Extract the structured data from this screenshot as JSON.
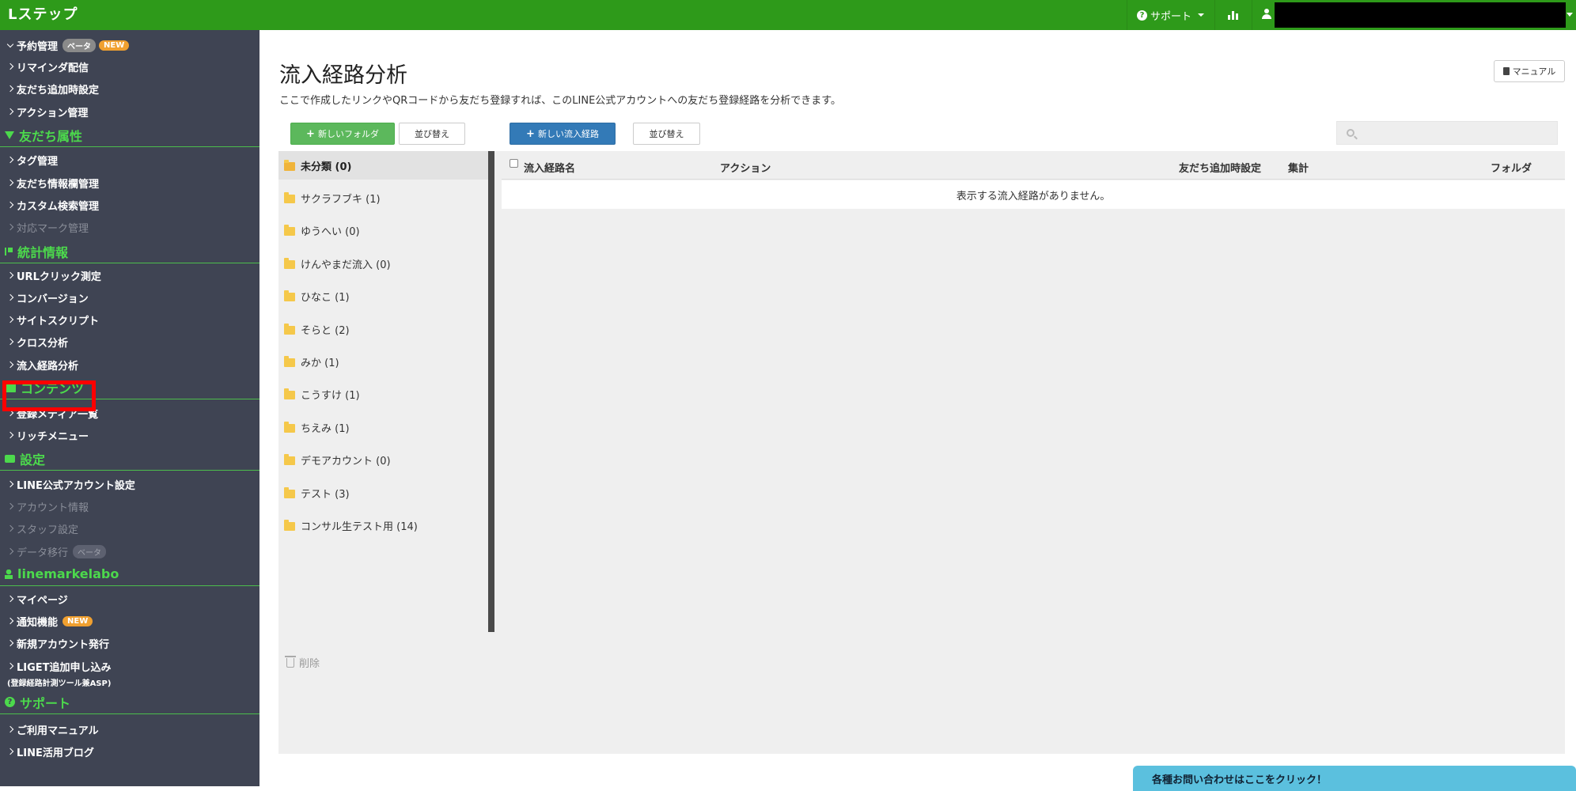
{
  "app": {
    "logo": "Lステップ"
  },
  "topbar": {
    "support_label": "サポート"
  },
  "sidebar": {
    "items": [
      {
        "label": "予約管理",
        "badges": [
          "ベータ",
          "NEW"
        ]
      },
      {
        "label": "リマインダ配信"
      },
      {
        "label": "友だち追加時設定"
      },
      {
        "label": "アクション管理"
      },
      {
        "label": "タグ管理"
      },
      {
        "label": "友だち情報欄管理"
      },
      {
        "label": "カスタム検索管理"
      },
      {
        "label": "対応マーク管理"
      },
      {
        "label": "URLクリック測定"
      },
      {
        "label": "コンバージョン"
      },
      {
        "label": "サイトスクリプト"
      },
      {
        "label": "クロス分析"
      },
      {
        "label": "流入経路分析"
      },
      {
        "label": "登録メディア一覧"
      },
      {
        "label": "リッチメニュー"
      },
      {
        "label": "LINE公式アカウント設定"
      },
      {
        "label": "アカウント情報"
      },
      {
        "label": "スタッフ設定"
      },
      {
        "label": "データ移行",
        "badge": "ベータ"
      },
      {
        "label": "マイページ"
      },
      {
        "label": "通知機能",
        "badge": "NEW"
      },
      {
        "label": "新規アカウント発行"
      },
      {
        "label": "LIGET追加申し込み",
        "sub": "(登録経路計測ツール兼ASP)"
      },
      {
        "label": "ご利用マニュアル"
      },
      {
        "label": "LINE活用ブログ"
      }
    ],
    "sections": {
      "friend_attr": "友だち属性",
      "stats": "統計情報",
      "contents": "コンテンツ",
      "settings": "設定",
      "account": "linemarkelabo",
      "support": "サポート"
    }
  },
  "page": {
    "title": "流入経路分析",
    "description": "ここで作成したリンクやQRコードから友だち登録すれば、このLINE公式アカウントへの友だち登録経路を分析できます。",
    "manual_label": "マニュアル"
  },
  "toolbar": {
    "new_folder": "新しいフォルダ",
    "sort_folder": "並び替え",
    "new_route": "新しい流入経路",
    "sort_route": "並び替え"
  },
  "folders": [
    {
      "label": "未分類 (0)",
      "active": true
    },
    {
      "label": "サクラフブキ (1)"
    },
    {
      "label": "ゆうへい (0)"
    },
    {
      "label": "けんやまだ流入 (0)"
    },
    {
      "label": "ひなこ (1)"
    },
    {
      "label": "そらと (2)"
    },
    {
      "label": "みか (1)"
    },
    {
      "label": "こうすけ (1)"
    },
    {
      "label": "ちえみ (1)"
    },
    {
      "label": "デモアカウント (0)"
    },
    {
      "label": "テスト (3)"
    },
    {
      "label": "コンサル生テスト用 (14)"
    }
  ],
  "table": {
    "headers": {
      "name": "流入経路名",
      "action": "アクション",
      "friend_add": "友だち追加時設定",
      "summary": "集計",
      "folder": "フォルダ"
    },
    "empty_message": "表示する流入経路がありません。"
  },
  "delete_label": "削除",
  "contact_label": "各種お問い合わせはここをクリック！",
  "colors": {
    "topbar": "#2e9a1a",
    "sidebar": "#3f4453",
    "section_green": "#4cd94c",
    "highlight": "#ff0000"
  }
}
